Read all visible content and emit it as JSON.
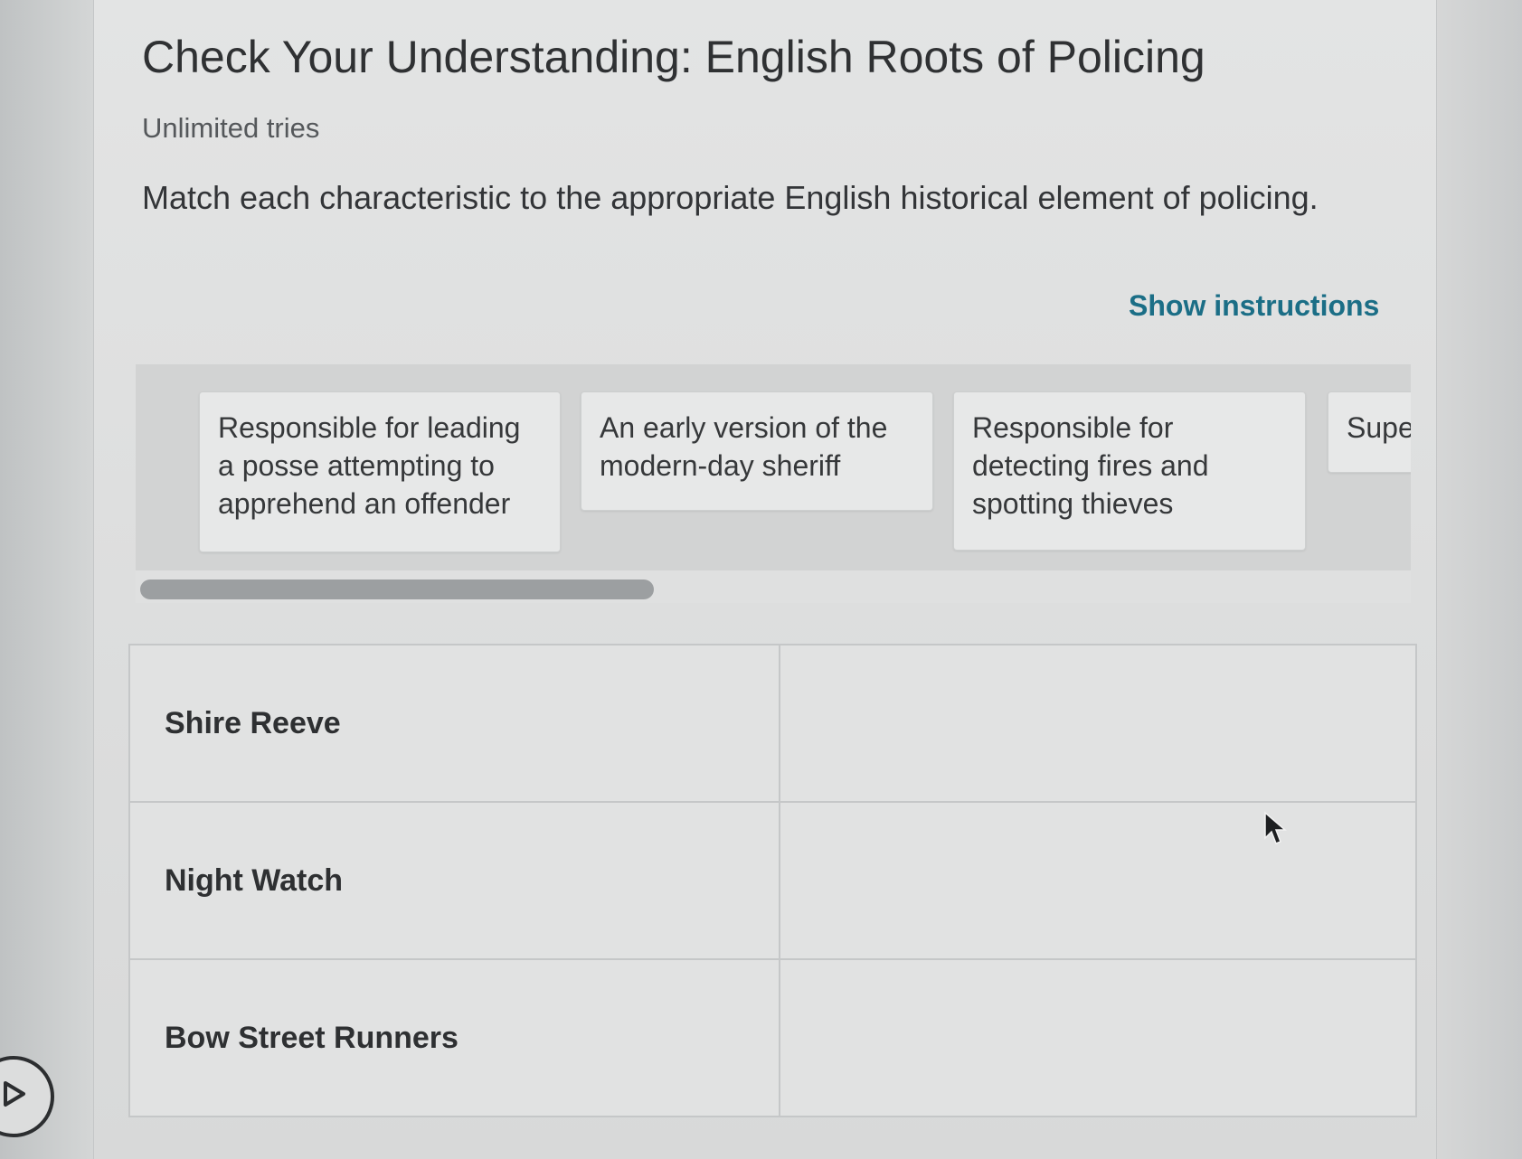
{
  "header": {
    "title": "Check Your Understanding: English Roots of Policing",
    "tries": "Unlimited tries",
    "prompt": "Match each characteristic to the appropriate English historical element of policing."
  },
  "instructions_link": "Show instructions",
  "answer_bank": {
    "cards": [
      {
        "text": "Responsible for leading a posse attempting to apprehend an offender"
      },
      {
        "text": "An early version of the modern-day sheriff"
      },
      {
        "text": "Responsible for detecting fires and spotting thieves"
      },
      {
        "text": "Supe"
      }
    ]
  },
  "match_table": {
    "rows": [
      {
        "label": "Shire Reeve",
        "answer": ""
      },
      {
        "label": "Night Watch",
        "answer": ""
      },
      {
        "label": "Bow Street Runners",
        "answer": ""
      }
    ]
  },
  "icons": {
    "cursor": "mouse-pointer-icon",
    "corner": "pencil-circle-icon"
  },
  "colors": {
    "link": "#1b6e86",
    "text": "#2f3133",
    "bank_background": "#d2d3d3",
    "scroll_thumb": "#9c9fa1"
  }
}
